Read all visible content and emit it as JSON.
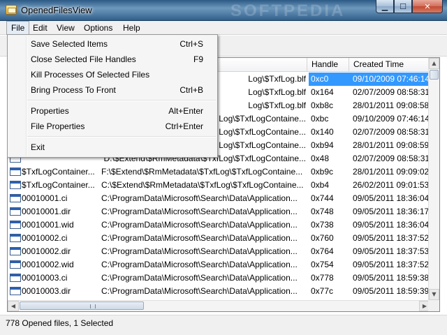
{
  "window": {
    "title": "OpenedFilesView",
    "watermark": "SOFTPEDIA"
  },
  "menu": [
    "File",
    "Edit",
    "View",
    "Options",
    "Help"
  ],
  "file_menu": {
    "group1": [
      {
        "label": "Save Selected Items",
        "shortcut": "Ctrl+S"
      },
      {
        "label": "Close Selected File Handles",
        "shortcut": "F9"
      },
      {
        "label": "Kill Processes Of Selected Files",
        "shortcut": ""
      },
      {
        "label": "Bring Process To Front",
        "shortcut": "Ctrl+B"
      }
    ],
    "group2": [
      {
        "label": "Properties",
        "shortcut": "Alt+Enter"
      },
      {
        "label": "File Properties",
        "shortcut": "Ctrl+Enter"
      }
    ],
    "group3": [
      {
        "label": "Exit",
        "shortcut": ""
      }
    ]
  },
  "columns": {
    "handle": "Handle",
    "created": "Created Time"
  },
  "rows": [
    {
      "name": "",
      "path": "Log\\$TxfLog.blf",
      "handle": "0xc0",
      "created": "09/10/2009 07:46:14",
      "selected": true
    },
    {
      "name": "",
      "path": "Log\\$TxfLog.blf",
      "handle": "0x164",
      "created": "02/07/2009 08:58:31"
    },
    {
      "name": "",
      "path": "Log\\$TxfLog.blf",
      "handle": "0xb8c",
      "created": "28/01/2011 09:08:58"
    },
    {
      "name": "",
      "path": "Log\\$TxfLogContaine...",
      "handle": "0xbc",
      "created": "09/10/2009 07:46:14"
    },
    {
      "name": "",
      "path": "Log\\$TxfLogContaine...",
      "handle": "0x140",
      "created": "02/07/2009 08:58:31"
    },
    {
      "name": "",
      "path": "Log\\$TxfLogContaine...",
      "handle": "0xb94",
      "created": "28/01/2011 09:08:59"
    },
    {
      "name": "",
      "path": "D:\\$Extend\\$RmMetadata\\$TxfLog\\$TxfLogContaine...",
      "handle": "0x48",
      "created": "02/07/2009 08:58:31"
    },
    {
      "name": "$TxfLogContainer...",
      "path": "F:\\$Extend\\$RmMetadata\\$TxfLog\\$TxfLogContaine...",
      "handle": "0xb9c",
      "created": "28/01/2011 09:09:02"
    },
    {
      "name": "$TxfLogContainer...",
      "path": "C:\\$Extend\\$RmMetadata\\$TxfLog\\$TxfLogContaine...",
      "handle": "0xb4",
      "created": "26/02/2011 09:01:53"
    },
    {
      "name": "00010001.ci",
      "path": "C:\\ProgramData\\Microsoft\\Search\\Data\\Application...",
      "handle": "0x744",
      "created": "09/05/2011 18:36:04"
    },
    {
      "name": "00010001.dir",
      "path": "C:\\ProgramData\\Microsoft\\Search\\Data\\Application...",
      "handle": "0x748",
      "created": "09/05/2011 18:36:17"
    },
    {
      "name": "00010001.wid",
      "path": "C:\\ProgramData\\Microsoft\\Search\\Data\\Application...",
      "handle": "0x738",
      "created": "09/05/2011 18:36:04"
    },
    {
      "name": "00010002.ci",
      "path": "C:\\ProgramData\\Microsoft\\Search\\Data\\Application...",
      "handle": "0x760",
      "created": "09/05/2011 18:37:52"
    },
    {
      "name": "00010002.dir",
      "path": "C:\\ProgramData\\Microsoft\\Search\\Data\\Application...",
      "handle": "0x764",
      "created": "09/05/2011 18:37:53"
    },
    {
      "name": "00010002.wid",
      "path": "C:\\ProgramData\\Microsoft\\Search\\Data\\Application...",
      "handle": "0x754",
      "created": "09/05/2011 18:37:52"
    },
    {
      "name": "00010003.ci",
      "path": "C:\\ProgramData\\Microsoft\\Search\\Data\\Application...",
      "handle": "0x778",
      "created": "09/05/2011 18:59:38"
    },
    {
      "name": "00010003.dir",
      "path": "C:\\ProgramData\\Microsoft\\Search\\Data\\Application...",
      "handle": "0x77c",
      "created": "09/05/2011 18:59:39"
    }
  ],
  "status": {
    "text": "778 Opened files, 1 Selected"
  },
  "icons": {
    "app": "app-icon",
    "file": "file-icon",
    "minimize": "minimize-icon",
    "maximize": "maximize-icon",
    "close": "close-icon"
  },
  "colors": {
    "selection": "#3399ff",
    "titlebar": "#5b86ad"
  }
}
